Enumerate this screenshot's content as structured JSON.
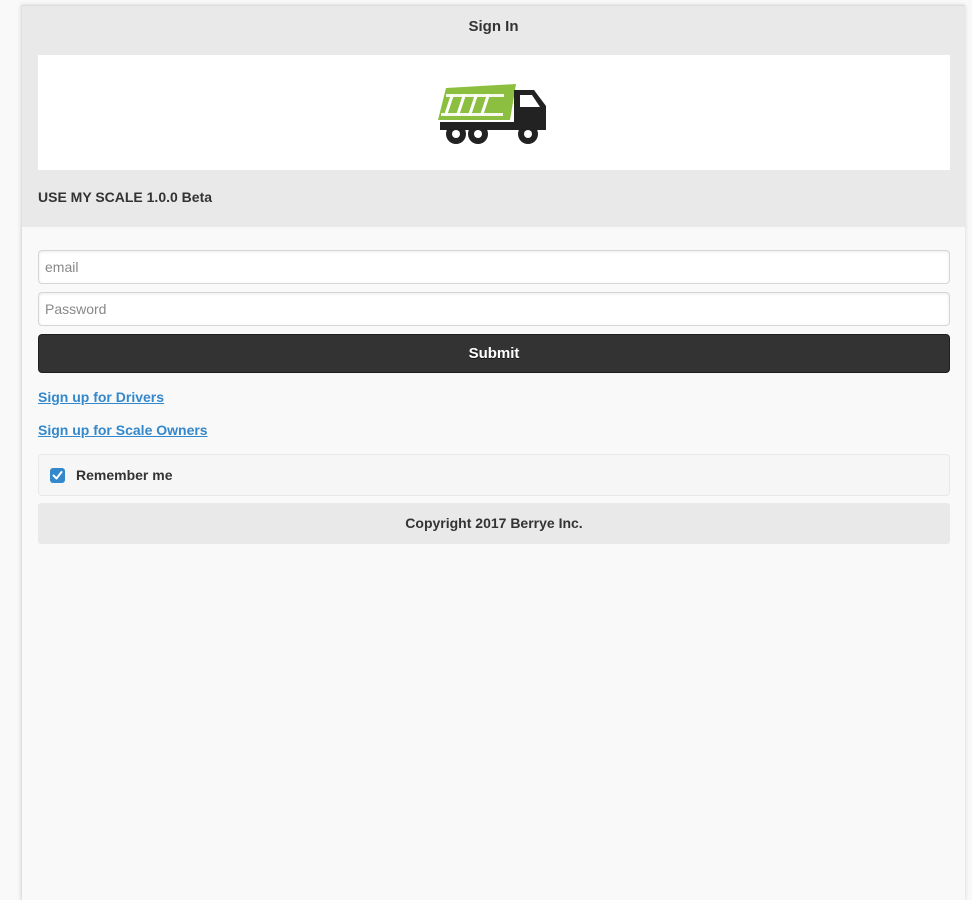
{
  "header": {
    "title": "Sign In",
    "logo_icon": "dump-truck-icon",
    "app_version": "USE MY SCALE 1.0.0 Beta"
  },
  "form": {
    "email_placeholder": "email",
    "email_value": "",
    "password_placeholder": "Password",
    "password_value": "",
    "submit_label": "Submit"
  },
  "links": {
    "drivers": "Sign up for Drivers",
    "scale_owners": "Sign up for Scale Owners"
  },
  "remember": {
    "label": "Remember me",
    "checked": true
  },
  "footer": {
    "copyright": "Copyright 2017 Berrye Inc."
  },
  "colors": {
    "accent": "#3388cc",
    "button_dark": "#333333",
    "truck_bed": "#8cbf3f",
    "header_bg": "#e9e9e9"
  }
}
